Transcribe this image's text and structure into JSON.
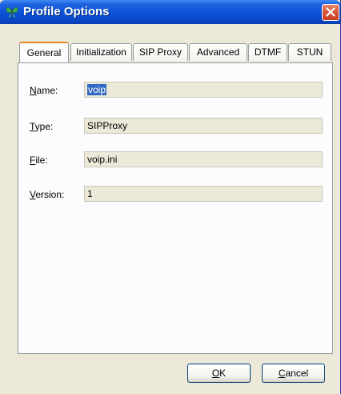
{
  "window": {
    "title": "Profile Options",
    "app_icon": "butterfly-icon",
    "close_icon": "close-icon"
  },
  "tabs": [
    {
      "label": "General",
      "active": true
    },
    {
      "label": "Initialization",
      "active": false
    },
    {
      "label": "SIP Proxy",
      "active": false
    },
    {
      "label": "Advanced",
      "active": false
    },
    {
      "label": "DTMF",
      "active": false
    },
    {
      "label": "STUN",
      "active": false
    }
  ],
  "fields": {
    "name": {
      "label_mnemonic": "N",
      "label_rest": "ame:",
      "value": "voip",
      "selected": true
    },
    "type": {
      "label_mnemonic": "T",
      "label_rest": "ype:",
      "value": "SIPProxy"
    },
    "file": {
      "label_mnemonic": "F",
      "label_rest": "ile:",
      "value": "voip.ini"
    },
    "version": {
      "label_mnemonic": "V",
      "label_rest": "ersion:",
      "value": "1"
    }
  },
  "buttons": {
    "ok": {
      "mnemonic": "O",
      "rest": "K"
    },
    "cancel": {
      "mnemonic": "C",
      "rest": "ancel"
    }
  },
  "colors": {
    "titlebar": "#0a53d8",
    "close_button": "#d8573a",
    "tab_highlight": "#e68b2c",
    "selection": "#316ac5",
    "dialog_face": "#ece9d8"
  }
}
